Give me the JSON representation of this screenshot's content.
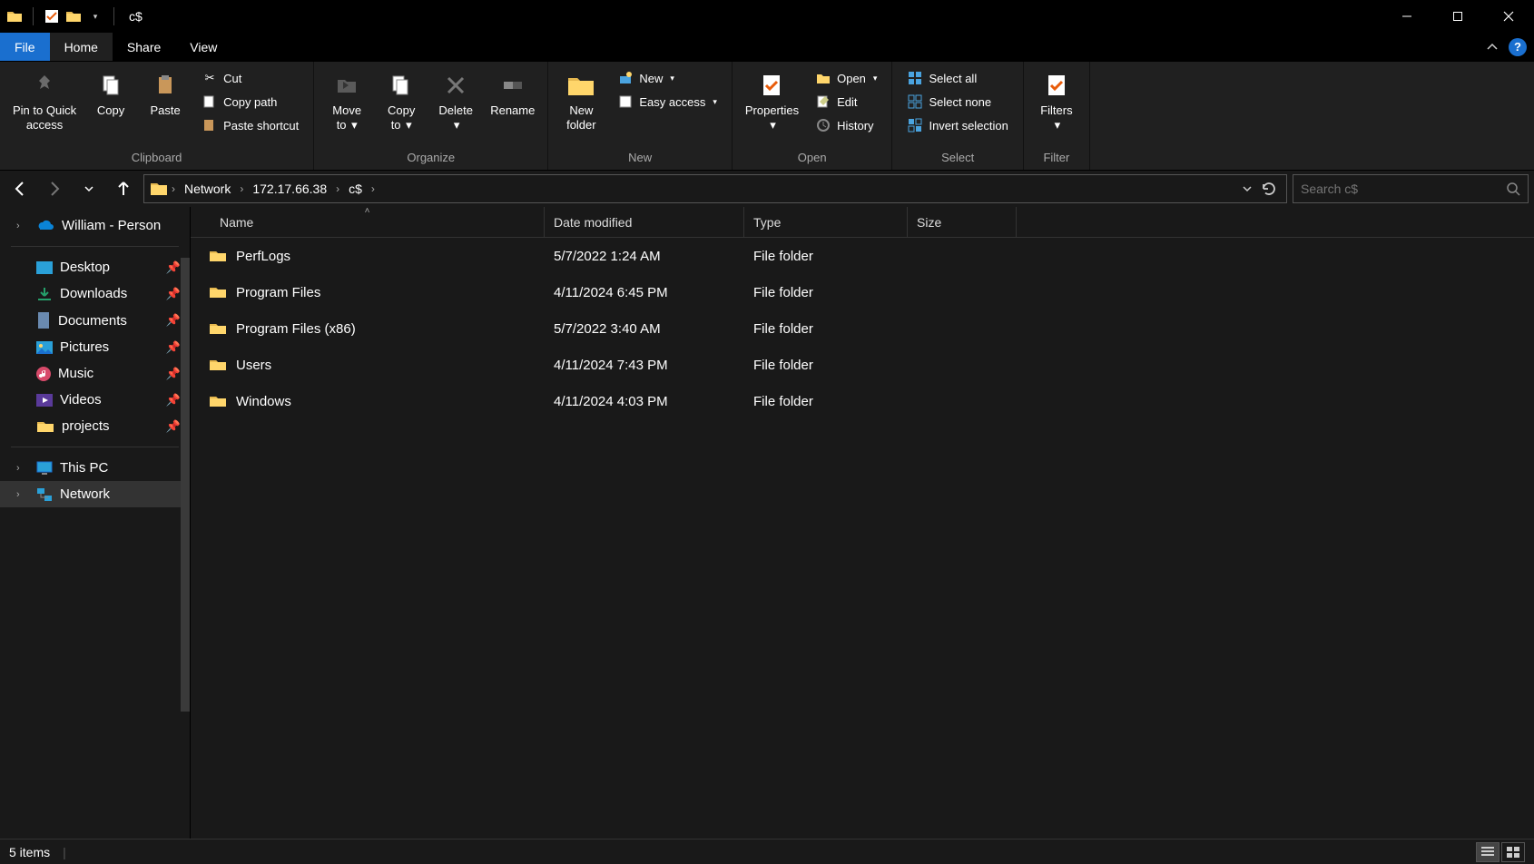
{
  "window": {
    "title": "c$"
  },
  "tabs": {
    "file": "File",
    "home": "Home",
    "share": "Share",
    "view": "View"
  },
  "ribbon": {
    "clipboard": {
      "label": "Clipboard",
      "pin": "Pin to Quick\naccess",
      "copy": "Copy",
      "paste": "Paste",
      "cut": "Cut",
      "copy_path": "Copy path",
      "paste_shortcut": "Paste shortcut"
    },
    "organize": {
      "label": "Organize",
      "move_to": "Move\nto",
      "copy_to": "Copy\nto",
      "delete": "Delete",
      "rename": "Rename"
    },
    "new": {
      "label": "New",
      "new_folder": "New\nfolder",
      "new_item": "New",
      "easy_access": "Easy access"
    },
    "open": {
      "label": "Open",
      "properties": "Properties",
      "open": "Open",
      "edit": "Edit",
      "history": "History"
    },
    "select": {
      "label": "Select",
      "select_all": "Select all",
      "select_none": "Select none",
      "invert": "Invert selection"
    },
    "filter": {
      "label": "Filter",
      "filters": "Filters"
    }
  },
  "breadcrumb": {
    "p0": "Network",
    "p1": "172.17.66.38",
    "p2": "c$"
  },
  "search": {
    "placeholder": "Search c$"
  },
  "columns": {
    "name": "Name",
    "date": "Date modified",
    "type": "Type",
    "size": "Size"
  },
  "nav": {
    "user": "William - Person",
    "desktop": "Desktop",
    "downloads": "Downloads",
    "documents": "Documents",
    "pictures": "Pictures",
    "music": "Music",
    "videos": "Videos",
    "projects": "projects",
    "this_pc": "This PC",
    "network": "Network"
  },
  "files": [
    {
      "name": "PerfLogs",
      "date": "5/7/2022 1:24 AM",
      "type": "File folder",
      "size": ""
    },
    {
      "name": "Program Files",
      "date": "4/11/2024 6:45 PM",
      "type": "File folder",
      "size": ""
    },
    {
      "name": "Program Files (x86)",
      "date": "5/7/2022 3:40 AM",
      "type": "File folder",
      "size": ""
    },
    {
      "name": "Users",
      "date": "4/11/2024 7:43 PM",
      "type": "File folder",
      "size": ""
    },
    {
      "name": "Windows",
      "date": "4/11/2024 4:03 PM",
      "type": "File folder",
      "size": ""
    }
  ],
  "status": {
    "items": "5 items"
  }
}
